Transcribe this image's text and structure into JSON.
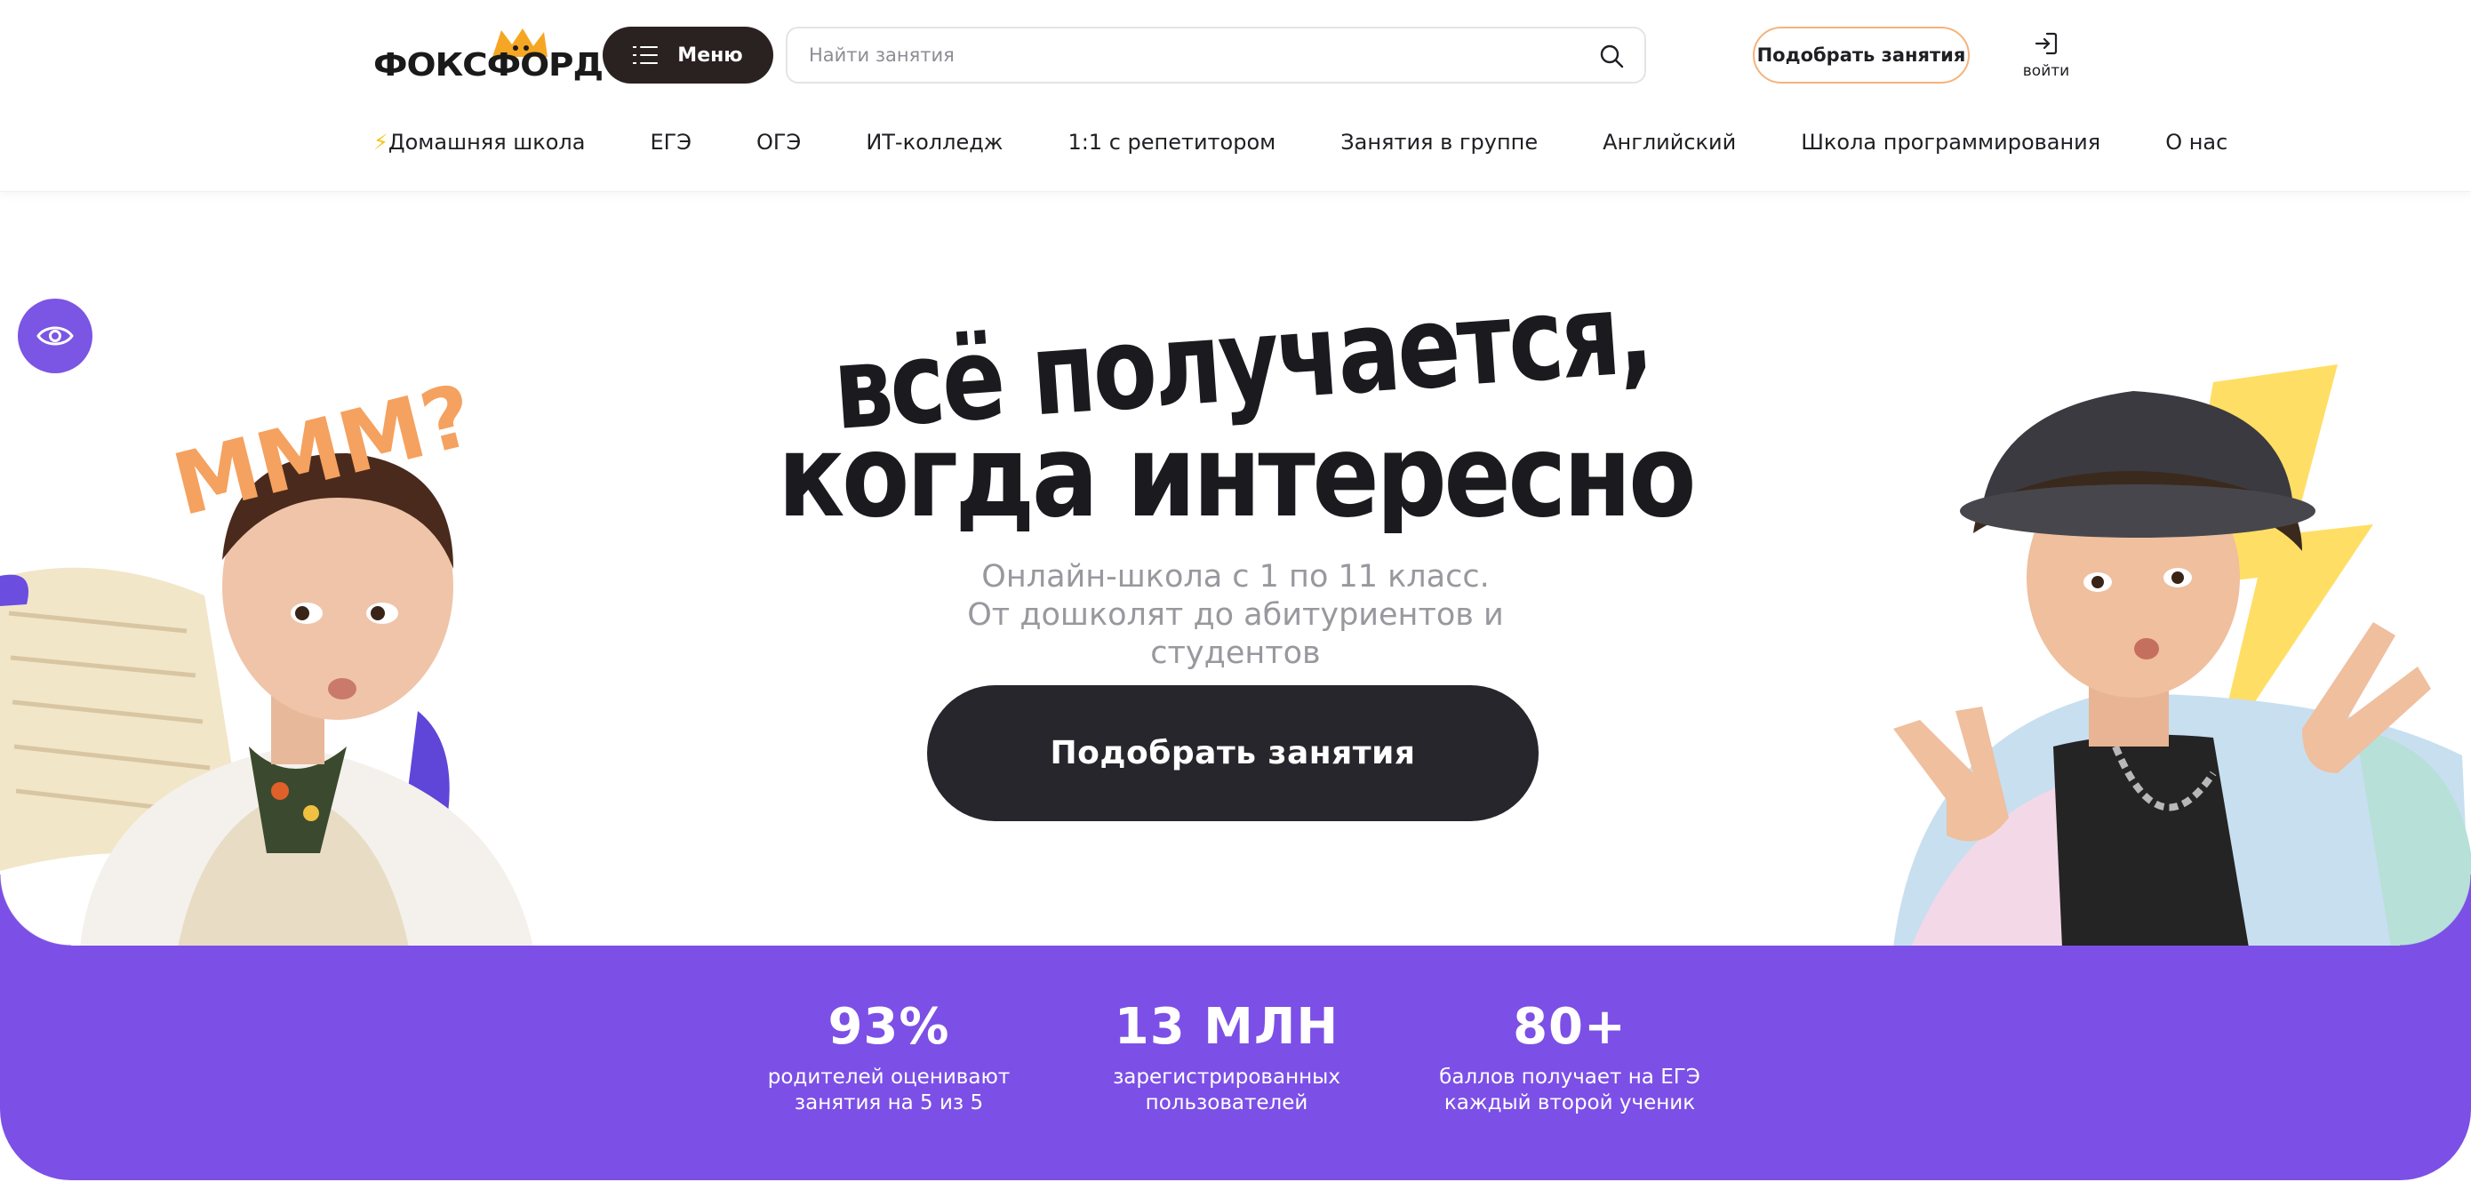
{
  "header": {
    "logo_text": "ФОКСФОРД",
    "menu_label": "Меню",
    "search_placeholder": "Найти занятия",
    "pick_button": "Подобрать занятия",
    "login_label": "войти"
  },
  "nav": {
    "items": [
      {
        "label": "Домашняя школа",
        "icon": "lightning-icon"
      },
      {
        "label": "ЕГЭ"
      },
      {
        "label": "ОГЭ"
      },
      {
        "label": "ИТ-колледж"
      },
      {
        "label": "1:1 с репетитором"
      },
      {
        "label": "Занятия в группе"
      },
      {
        "label": "Английский"
      },
      {
        "label": "Школа программирования"
      },
      {
        "label": "О нас"
      }
    ]
  },
  "hero": {
    "title_line1": "всё получается,",
    "title_line2": "когда интересно",
    "sticker": "МММ?",
    "subtitle_line1": "Онлайн-школа с 1 по 11 класс.",
    "subtitle_line2": "От дошколят до абитуриентов и студентов",
    "cta": "Подобрать занятия"
  },
  "stats": [
    {
      "value": "93%",
      "text_line1": "родителей оценивают",
      "text_line2": "занятия на 5 из 5"
    },
    {
      "value": "13 МЛН",
      "text_line1": "зарегистрированных",
      "text_line2": "пользователей"
    },
    {
      "value": "80+",
      "text_line1": "баллов получает на ЕГЭ",
      "text_line2": "каждый второй ученик"
    }
  ],
  "colors": {
    "accent_purple": "#7c4fe6",
    "dark": "#27262c",
    "orange_outline": "#f6b27a",
    "sticker_orange": "#f5a15f"
  }
}
